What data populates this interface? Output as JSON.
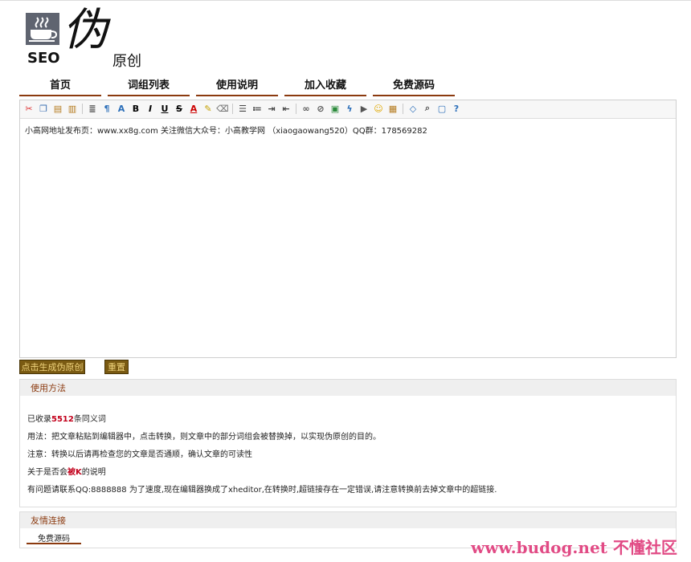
{
  "logo": {
    "seo_text": "SEO",
    "brand_char": "伪",
    "brand_suffix": "原创"
  },
  "nav": {
    "items": [
      "首页",
      "词组列表",
      "使用说明",
      "加入收藏",
      "免费源码"
    ]
  },
  "editor": {
    "content": "小高网地址发布页：www.xx8g.com 关注微信大众号：小高教学网 （xiaogaowang520）QQ群：178569282",
    "toolbar_icons": [
      "cut-icon",
      "copy-icon",
      "paste-icon",
      "paste-text-icon",
      "format-block-icon",
      "spellcheck-icon",
      "font-size-icon",
      "bold-icon",
      "italic-icon",
      "underline-icon",
      "strikethrough-icon",
      "font-color-icon",
      "highlight-icon",
      "remove-format-icon",
      "align-icon",
      "list-icon",
      "indent-icon",
      "outdent-icon",
      "link-icon",
      "unlink-icon",
      "image-icon",
      "flash-icon",
      "media-icon",
      "emoticon-icon",
      "table-icon",
      "source-icon",
      "preview-icon",
      "fullscreen-icon",
      "about-icon"
    ]
  },
  "buttons": {
    "generate": "点击生成伪原创",
    "reset": "重置"
  },
  "usage": {
    "title": "使用方法",
    "count_prefix": "已收录",
    "count": "5512",
    "count_suffix": "条同义词",
    "line1": "用法：把文章粘贴到编辑器中，点击转换，则文章中的部分词组会被替换掉，以实现伪原创的目的。",
    "line2": "注意：转换以后请再检查您的文章是否通顺，确认文章的可读性",
    "line3_prefix": "关于是否会",
    "line3_highlight": "被K",
    "line3_suffix": "的说明",
    "line4": "有问题请联系QQ:8888888 为了速度,现在编辑器换成了xheditor,在转换时,超链接存在一定错误,请注意转换前去掉文章中的超链接."
  },
  "links": {
    "title": "友情连接",
    "items": [
      "免费源码"
    ]
  },
  "watermark": "www.budog.net 不懂社区",
  "colors": {
    "accent": "#8b3a0f",
    "button_bg": "#7a5a12",
    "button_text": "#efd37c",
    "highlight": "#c2001b"
  }
}
